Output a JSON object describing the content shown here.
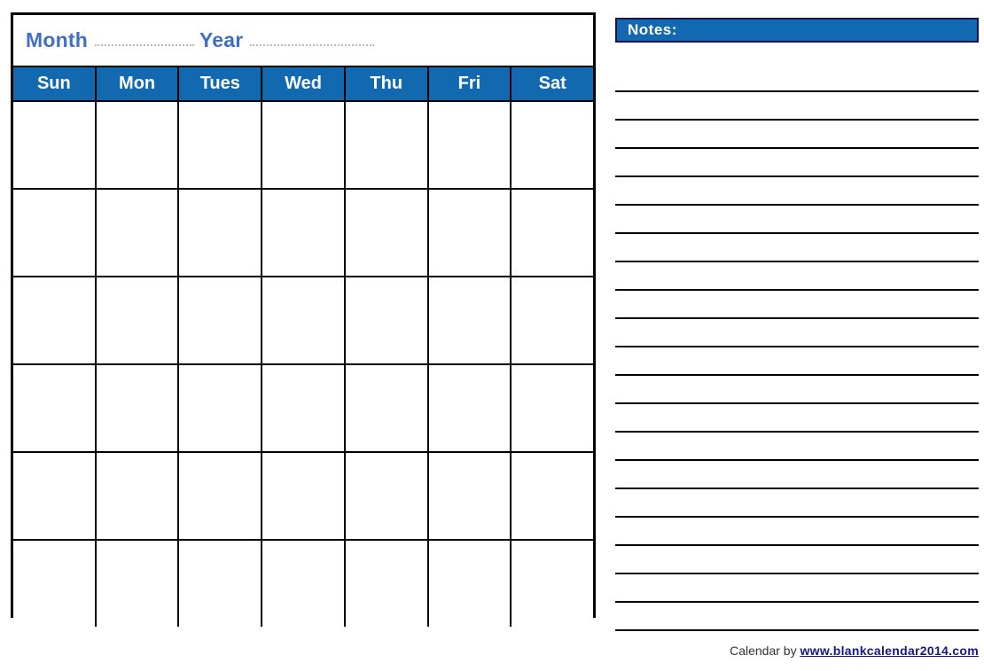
{
  "calendar": {
    "month_label": "Month",
    "year_label": "Year",
    "month_value": "",
    "year_value": "",
    "weekdays": [
      "Sun",
      "Mon",
      "Tues",
      "Wed",
      "Thu",
      "Fri",
      "Sat"
    ],
    "weeks": [
      [
        "",
        "",
        "",
        "",
        "",
        "",
        ""
      ],
      [
        "",
        "",
        "",
        "",
        "",
        "",
        ""
      ],
      [
        "",
        "",
        "",
        "",
        "",
        "",
        ""
      ],
      [
        "",
        "",
        "",
        "",
        "",
        "",
        ""
      ],
      [
        "",
        "",
        "",
        "",
        "",
        "",
        ""
      ],
      [
        "",
        "",
        "",
        "",
        "",
        "",
        ""
      ]
    ],
    "header_bg": "#1269b0",
    "header_text_color": "#ffffff",
    "label_color": "#4070c4",
    "border_color": "#000000"
  },
  "notes": {
    "title": "Notes:",
    "banner_bg": "#1269b0",
    "banner_border": "#13134f",
    "line_count": 20,
    "lines": [
      "",
      "",
      "",
      "",
      "",
      "",
      "",
      "",
      "",
      "",
      "",
      "",
      "",
      "",
      "",
      "",
      "",
      "",
      "",
      ""
    ]
  },
  "footer": {
    "prefix": "Calendar by ",
    "url": "www.blankcalendar2014.com",
    "url_color": "#171785"
  }
}
